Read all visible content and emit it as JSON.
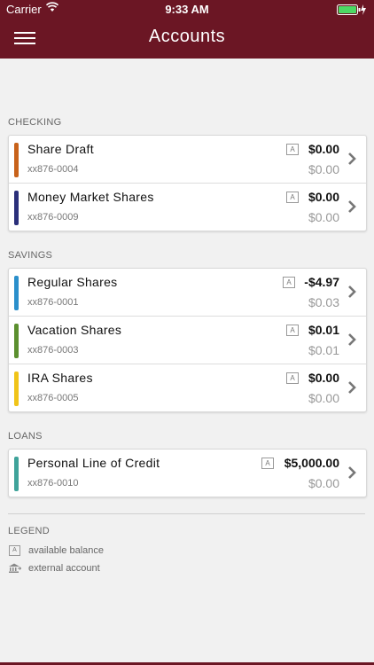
{
  "status_bar": {
    "carrier": "Carrier",
    "time": "9:33 AM"
  },
  "nav": {
    "title": "Accounts"
  },
  "sections": {
    "checking": {
      "label": "CHECKING",
      "accounts": [
        {
          "name": "Share Draft",
          "number": "xx876-0004",
          "balance": "$0.00",
          "available": "$0.00",
          "color": "#c8621a"
        },
        {
          "name": "Money Market Shares",
          "number": "xx876-0009",
          "balance": "$0.00",
          "available": "$0.00",
          "color": "#2a2f7a"
        }
      ]
    },
    "savings": {
      "label": "SAVINGS",
      "accounts": [
        {
          "name": "Regular Shares",
          "number": "xx876-0001",
          "balance": "-$4.97",
          "available": "$0.03",
          "color": "#2a8fcb"
        },
        {
          "name": "Vacation Shares",
          "number": "xx876-0003",
          "balance": "$0.01",
          "available": "$0.01",
          "color": "#5b8f2e"
        },
        {
          "name": "IRA Shares",
          "number": "xx876-0005",
          "balance": "$0.00",
          "available": "$0.00",
          "color": "#f0c419"
        }
      ]
    },
    "loans": {
      "label": "LOANS",
      "accounts": [
        {
          "name": "Personal Line of Credit",
          "number": "xx876-0010",
          "balance": "$5,000.00",
          "available": "$0.00",
          "color": "#3fa39a"
        }
      ]
    }
  },
  "badge_letter": "A",
  "legend": {
    "title": "LEGEND",
    "available_balance": "available balance",
    "external_account": "external account"
  },
  "colors": {
    "brand": "#6b1624"
  }
}
